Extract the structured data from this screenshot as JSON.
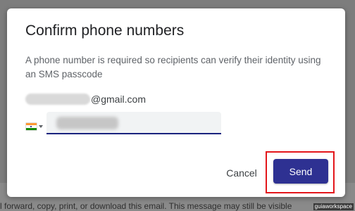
{
  "background": {
    "text": "l forward, copy, print, or download this email. This message may still be visible",
    "watermark": "guiaworkspace"
  },
  "dialog": {
    "title": "Confirm phone numbers",
    "description": "A phone number is required so recipients can verify their identity using an SMS passcode",
    "recipient": {
      "email_domain": "@gmail.com"
    },
    "phone": {
      "country_flag": "india-flag-icon",
      "value": ""
    },
    "buttons": {
      "cancel_label": "Cancel",
      "send_label": "Send"
    }
  },
  "colors": {
    "primary": "#2e3192",
    "highlight": "#e3161b",
    "input_underline": "#1a237e"
  }
}
